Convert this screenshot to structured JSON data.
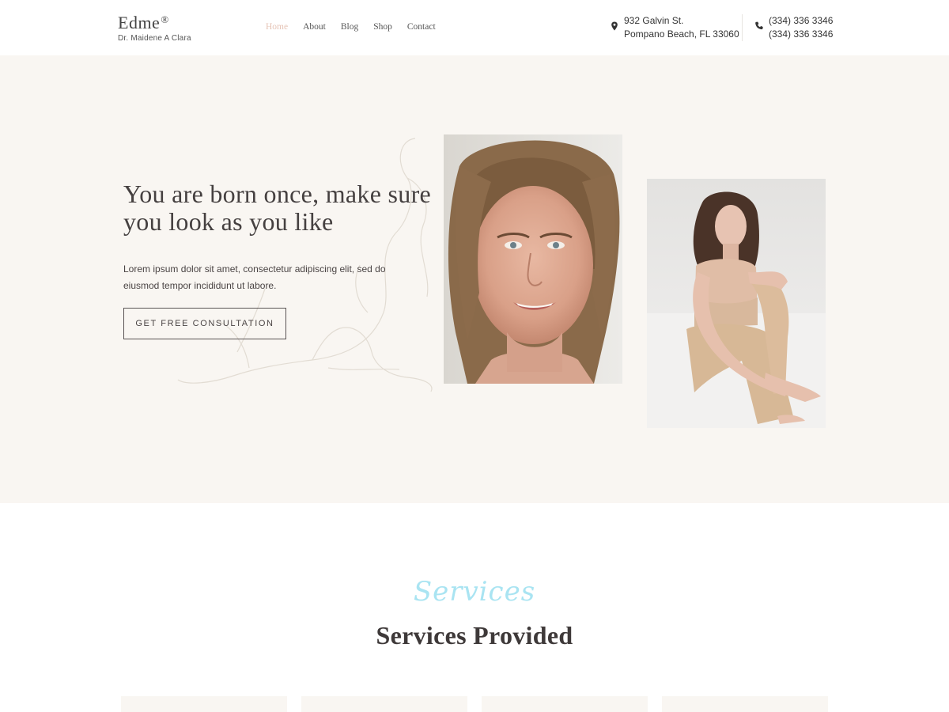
{
  "brand": {
    "name": "Edme",
    "mark": "®",
    "subtitle": "Dr. Maidene A Clara"
  },
  "nav": [
    {
      "label": "Home",
      "active": true
    },
    {
      "label": "About",
      "active": false
    },
    {
      "label": "Blog",
      "active": false
    },
    {
      "label": "Shop",
      "active": false
    },
    {
      "label": "Contact",
      "active": false
    }
  ],
  "contact": {
    "address_line1": "932 Galvin St.",
    "address_line2": "Pompano Beach, FL 33060",
    "phone_line1": "(334) 336 3346",
    "phone_line2": "(334) 336 3346",
    "address_icon": "map-pin-icon",
    "phone_icon": "phone-icon"
  },
  "hero": {
    "title": "You are born once, make sure you look as you like",
    "text": "Lorem ipsum dolor sit amet, consectetur adipiscing elit, sed do eiusmod tempor incididunt ut labore.",
    "cta_label": "GET FREE CONSULTATION"
  },
  "services": {
    "script_label": "Services",
    "title": "Services Provided",
    "card_count": 4
  },
  "colors": {
    "accent": "#e6c4b6",
    "hero_bg": "#f9f6f2",
    "script": "#a9e4f2",
    "text": "#3a3535"
  }
}
